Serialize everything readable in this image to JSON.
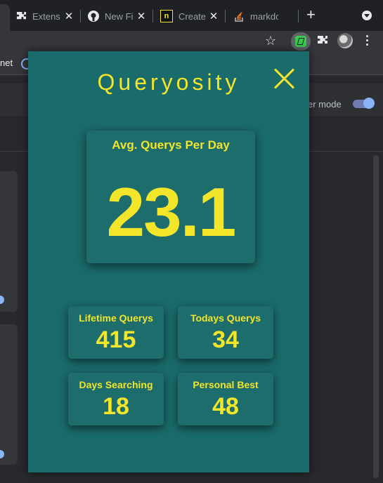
{
  "browser": {
    "tabs": [
      {
        "label": "Extensions",
        "icon": "puzzle-icon"
      },
      {
        "label": "New File",
        "icon": "github-icon"
      },
      {
        "label": "Create",
        "icon": "notion-icon"
      },
      {
        "label": "markdown",
        "icon": "stackoverflow-icon"
      }
    ],
    "new_tab": "+",
    "bookmark_text": "net"
  },
  "page": {
    "mode_label": "er mode"
  },
  "popup": {
    "title": "Queryosity",
    "average": {
      "label": "Avg. Querys Per Day",
      "value": "23.1"
    },
    "stats": [
      {
        "label": "Lifetime Querys",
        "value": "415"
      },
      {
        "label": "Todays Querys",
        "value": "34"
      },
      {
        "label": "Days Searching",
        "value": "18"
      },
      {
        "label": "Personal Best",
        "value": "48"
      }
    ]
  },
  "colors": {
    "popup_bg": "#1a6b6b",
    "accent": "#f2e52a",
    "chrome_bg": "#202124"
  }
}
